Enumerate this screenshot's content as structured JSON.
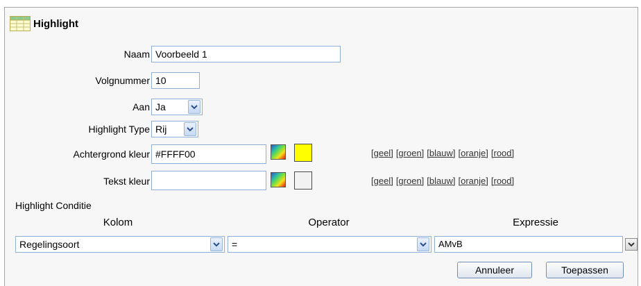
{
  "title": "Highlight",
  "form": {
    "naam": {
      "label": "Naam",
      "value": "Voorbeeld 1"
    },
    "volgnummer": {
      "label": "Volgnummer",
      "value": "10"
    },
    "aan": {
      "label": "Aan",
      "value": "Ja"
    },
    "highlight_type": {
      "label": "Highlight Type",
      "value": "Rij"
    },
    "achtergrond": {
      "label": "Achtergrond kleur",
      "value": "#FFFF00",
      "swatch_color": "#FFFF00"
    },
    "tekst": {
      "label": "Tekst kleur",
      "value": "",
      "swatch_color": "#f2f2f2"
    }
  },
  "color_links": [
    "[geel]",
    "[groen]",
    "[blauw]",
    "[oranje]",
    "[rood]"
  ],
  "condition": {
    "section_label": "Highlight Conditie",
    "col_kolom": "Kolom",
    "col_operator": "Operator",
    "col_expressie": "Expressie",
    "kolom_value": "Regelingsoort",
    "operator_value": "=",
    "expressie_value": "AMvB"
  },
  "buttons": {
    "cancel": "Annuleer",
    "apply": "Toepassen"
  },
  "icons": {
    "title": "table-grid-icon",
    "dropdown": "chevron-down-icon",
    "color_picker": "color-picker-icon"
  }
}
